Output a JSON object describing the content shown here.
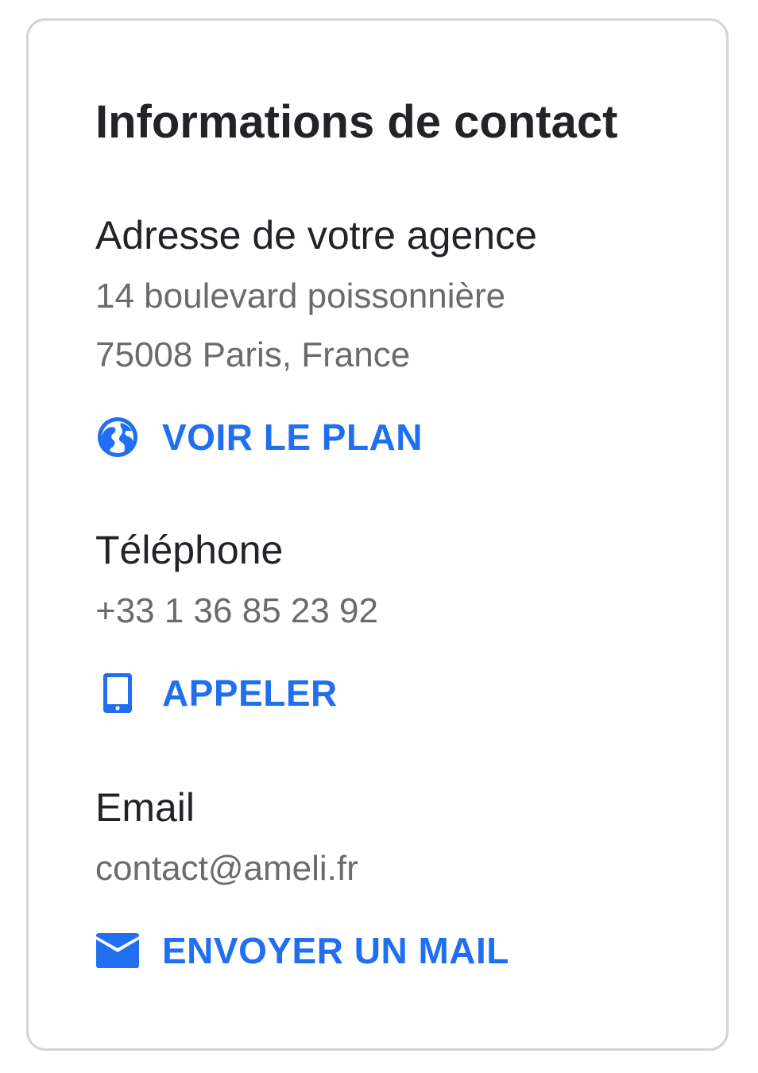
{
  "card": {
    "title": "Informations de contact",
    "address": {
      "label": "Adresse de votre agence",
      "line1": "14 boulevard poissonnière",
      "line2": "75008 Paris, France",
      "action_label": "VOIR LE PLAN",
      "action_icon": "globe-icon"
    },
    "phone": {
      "label": "Téléphone",
      "number": "+33 1 36 85 23 92",
      "action_label": "APPELER",
      "action_icon": "mobile-phone-icon"
    },
    "email": {
      "label": "Email",
      "address": "contact@ameli.fr",
      "action_label": "ENVOYER UN MAIL",
      "action_icon": "envelope-icon"
    }
  },
  "colors": {
    "accent": "#1f6ff0",
    "heading": "#212327",
    "muted": "#6b6b6b",
    "border": "#d4d4d4"
  }
}
